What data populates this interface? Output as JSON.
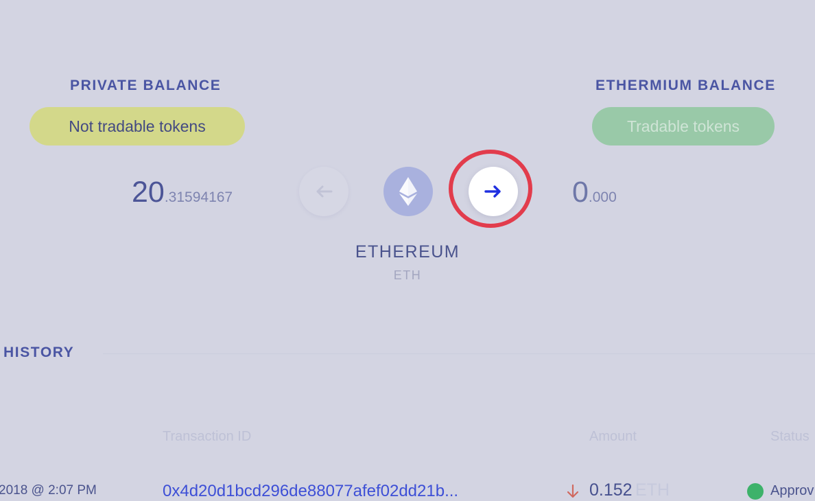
{
  "private": {
    "heading": "PRIVATE BALANCE",
    "badge": "Not tradable tokens",
    "balance_int": "20",
    "balance_dec": ".31594167"
  },
  "ethermium": {
    "heading": "ETHERMIUM BALANCE",
    "badge": "Tradable tokens",
    "balance_int": "0",
    "balance_dec": ".000"
  },
  "asset": {
    "name": "ETHEREUM",
    "symbol": "ETH",
    "icon": "ethereum-icon"
  },
  "history": {
    "heading": "HISTORY",
    "columns": {
      "transaction_id": "Transaction ID",
      "amount": "Amount",
      "status": "Status"
    },
    "rows": [
      {
        "date": "2018 @ 2:07 PM",
        "tx_id": "0x4d20d1bcd296de88077afef02dd21b...",
        "direction_icon": "arrow-down-icon",
        "amount": "0.152",
        "unit": "ETH",
        "status": "Approv"
      }
    ]
  },
  "colors": {
    "background": "#d3d4e2",
    "accent": "#4a55a3",
    "private_badge": "#d3d88a",
    "ethermium_badge": "#99c9a8",
    "highlight": "#e23c4c",
    "status_ok": "#3db26a"
  }
}
